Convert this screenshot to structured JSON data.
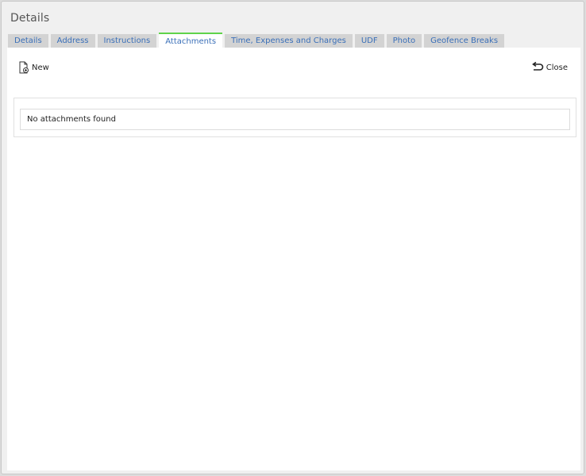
{
  "dialog": {
    "title": "Details"
  },
  "tabs": [
    {
      "label": "Details",
      "active": false
    },
    {
      "label": "Address",
      "active": false
    },
    {
      "label": "Instructions",
      "active": false
    },
    {
      "label": "Attachments",
      "active": true
    },
    {
      "label": "Time, Expenses and Charges",
      "active": false
    },
    {
      "label": "UDF",
      "active": false
    },
    {
      "label": "Photo",
      "active": false
    },
    {
      "label": "Geofence Breaks",
      "active": false
    }
  ],
  "toolbar": {
    "new_label": "New",
    "new_icon": "new-file-icon",
    "close_label": "Close",
    "close_icon": "undo-arrow-icon"
  },
  "attachments": {
    "empty_message": "No attachments found"
  },
  "colors": {
    "active_tab_accent": "#5fd34a",
    "tab_text": "#3a6fb8",
    "tab_bg": "#d3d3d3"
  }
}
